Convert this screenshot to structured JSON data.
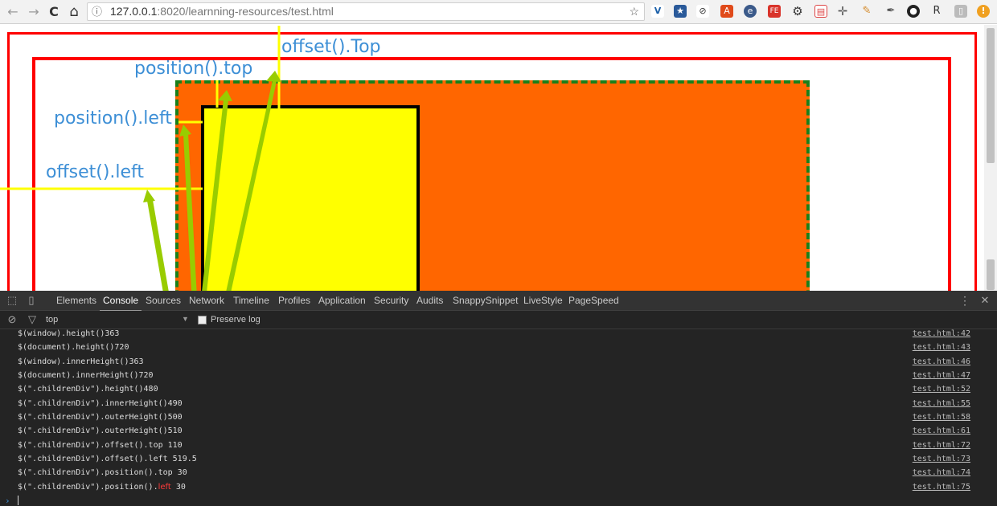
{
  "browser": {
    "back": "←",
    "forward": "→",
    "reload": "C",
    "home": "⌂",
    "info": "ⓘ",
    "url_host": "127.0.0.1",
    "url_rest": ":8020/learnning-resources/test.html",
    "star": "☆"
  },
  "annotations": {
    "offset_top": "offset().Top",
    "position_top": "position().top",
    "position_left": "position().left",
    "offset_left": "offset().left"
  },
  "devtools": {
    "tabs": [
      "Elements",
      "Console",
      "Sources",
      "Network",
      "Timeline",
      "Profiles",
      "Application",
      "Security",
      "Audits",
      "SnappySnippet",
      "LiveStyle",
      "PageSpeed"
    ],
    "active_tab": "Console",
    "filter_context": "top",
    "preserve_log": "Preserve log",
    "more": "⋮",
    "close": "✕",
    "logs": [
      {
        "msg": "$(window).height()363",
        "src": "test.html:42"
      },
      {
        "msg": "$(document).height()720",
        "src": "test.html:43"
      },
      {
        "msg": "$(window).innerHeight()363",
        "src": "test.html:46"
      },
      {
        "msg": "$(document).innerHeight()720",
        "src": "test.html:47"
      },
      {
        "msg": "$(\".childrenDiv\").height()480",
        "src": "test.html:52"
      },
      {
        "msg": "$(\".childrenDiv\").innerHeight()490",
        "src": "test.html:55"
      },
      {
        "msg": "$(\".childrenDiv\").outerHeight()500",
        "src": "test.html:58"
      },
      {
        "msg": "$(\".childrenDiv\").outerHeight()510",
        "src": "test.html:61"
      },
      {
        "msg": "$(\".childrenDiv\").offset().top 110",
        "src": "test.html:72"
      },
      {
        "msg": "$(\".childrenDiv\").offset().left 519.5",
        "src": "test.html:73"
      },
      {
        "msg": "$(\".childrenDiv\").position().top 30",
        "src": "test.html:74"
      },
      {
        "msg": "$(\".childrenDiv\").position().",
        "hl": "left",
        "tail": " 30",
        "src": "test.html:75"
      }
    ],
    "prompt": "›"
  },
  "colors": {
    "annotation": "#3d8fd6",
    "arrow": "#99cc00",
    "red_border": "#ff0000",
    "orange": "#ff6600",
    "yellow": "#ffff00"
  }
}
